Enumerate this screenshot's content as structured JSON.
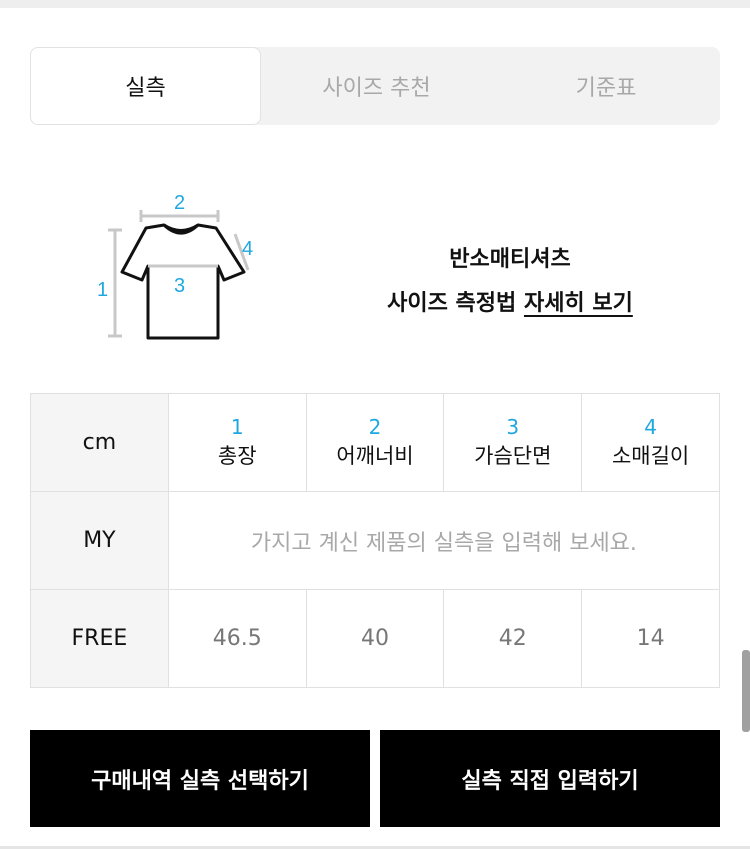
{
  "tabs": [
    {
      "label": "실측",
      "active": true
    },
    {
      "label": "사이즈 추천",
      "active": false
    },
    {
      "label": "기준표",
      "active": false
    }
  ],
  "diagram": {
    "labels": [
      "1",
      "2",
      "3",
      "4"
    ],
    "accent_color": "#1fa8e0"
  },
  "guide": {
    "product": "반소매티셔츠",
    "line2_prefix": "사이즈 측정법",
    "link": "자세히 보기"
  },
  "table": {
    "unit": "cm",
    "columns": [
      {
        "num": "1",
        "name": "총장"
      },
      {
        "num": "2",
        "name": "어깨너비"
      },
      {
        "num": "3",
        "name": "가슴단면"
      },
      {
        "num": "4",
        "name": "소매길이"
      }
    ],
    "my_row": {
      "label": "MY",
      "placeholder": "가지고 계신 제품의 실측을 입력해 보세요."
    },
    "rows": [
      {
        "label": "FREE",
        "values": [
          "46.5",
          "40",
          "42",
          "14"
        ]
      }
    ]
  },
  "buttons": {
    "purchase": "구매내역 실측 선택하기",
    "manual": "실측 직접 입력하기"
  }
}
